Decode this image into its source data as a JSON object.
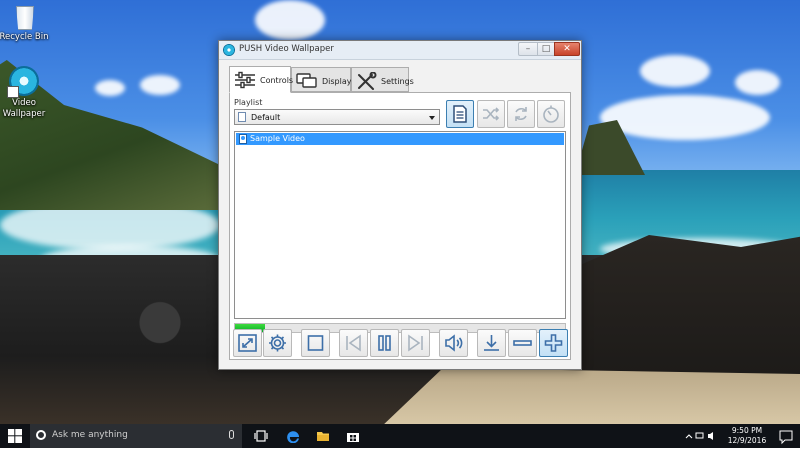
{
  "desktop": {
    "icons": [
      {
        "label": "Recycle Bin",
        "icon": "recycle-bin-icon"
      },
      {
        "label": "Video Wallpaper",
        "icon": "video-wallpaper-icon"
      }
    ]
  },
  "window": {
    "title": "PUSH Video Wallpaper",
    "controls": {
      "minimize": "–",
      "maximize": "□",
      "close": "✕"
    },
    "tabs": [
      {
        "label": "Controls",
        "icon": "sliders-icon",
        "active": true
      },
      {
        "label": "Displays",
        "icon": "displays-icon",
        "active": false
      },
      {
        "label": "Settings",
        "icon": "wrench-screwdriver-icon",
        "active": false
      }
    ],
    "playlist": {
      "label": "Playlist",
      "selected": "Default",
      "items": [
        {
          "name": "Sample Video",
          "selected": true
        }
      ]
    },
    "playlist_buttons": [
      {
        "icon": "playlist-icon",
        "selected": true
      },
      {
        "icon": "shuffle-icon",
        "selected": false
      },
      {
        "icon": "repeat-icon",
        "selected": false
      },
      {
        "icon": "timer-icon",
        "selected": false
      }
    ],
    "progress_fraction": 0.09,
    "bottom_buttons": [
      {
        "icon": "fullscreen-icon"
      },
      {
        "icon": "settings-gear-icon"
      },
      {
        "icon": "stop-icon"
      },
      {
        "icon": "previous-icon"
      },
      {
        "icon": "pause-icon"
      },
      {
        "icon": "next-icon"
      },
      {
        "icon": "volume-icon"
      },
      {
        "icon": "download-icon"
      },
      {
        "icon": "remove-icon"
      },
      {
        "icon": "add-icon"
      }
    ]
  },
  "taskbar": {
    "search_placeholder": "Ask me anything",
    "pinned": [
      "task-view-icon",
      "edge-icon",
      "file-explorer-icon",
      "store-icon"
    ],
    "clock": {
      "time": "9:50 PM",
      "date": "12/9/2016"
    }
  },
  "colors": {
    "selection": "#3399ff",
    "progress": "#06b025",
    "taskbar": "#0f1217",
    "icon_blue": "#3d6fa8"
  }
}
